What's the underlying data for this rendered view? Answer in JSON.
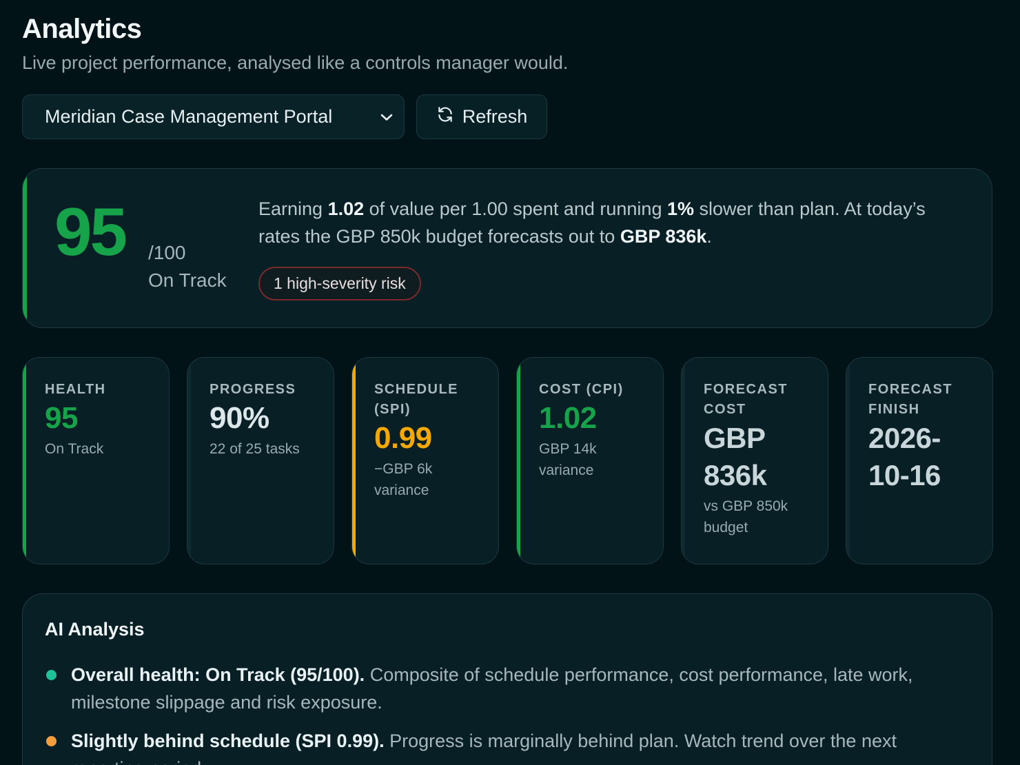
{
  "header": {
    "title": "Analytics",
    "subtitle": "Live project performance, analysed like a controls manager would."
  },
  "controls": {
    "project_select": "Meridian Case Management Portal",
    "refresh_label": "Refresh"
  },
  "hero": {
    "score": "95",
    "max": "/100",
    "status": "On Track",
    "text_parts": {
      "p1": "Earning ",
      "b1": "1.02",
      "p2": " of value per 1.00 spent and running ",
      "b2": "1%",
      "p3": " slower than plan. At today’s rates the GBP 850k budget forecasts out to ",
      "b3": "GBP 836k",
      "p4": "."
    },
    "risk_pill": "1 high-severity risk"
  },
  "cards": [
    {
      "label": "Health",
      "value": "95",
      "sub": "On Track",
      "accent": "#16a34a",
      "value_color": "#16a34a"
    },
    {
      "label": "Progress",
      "value": "90%",
      "sub": "22 of 25 tasks",
      "accent": "#0f2a30",
      "value_color": "#dde7e9"
    },
    {
      "label": "Schedule (SPI)",
      "value": "0.99",
      "sub": "−GBP 6k variance",
      "accent": "#f5a800",
      "value_color": "#f5a800"
    },
    {
      "label": "Cost (CPI)",
      "value": "1.02",
      "sub": "GBP 14k variance",
      "accent": "#16a34a",
      "value_color": "#16a34a"
    },
    {
      "label": "Forecast Cost",
      "value": "GBP 836k",
      "sub": "vs GBP 850k budget",
      "accent": "#0f2a30",
      "value_color": "#c8d6d9"
    },
    {
      "label": "Forecast Finish",
      "value": "2026-10-16",
      "sub": "",
      "accent": "#0f2a30",
      "value_color": "#c8d6d9"
    }
  ],
  "analysis": {
    "title": "AI Analysis",
    "items": [
      {
        "bold": "Overall health: On Track (95/100).",
        "text": " Composite of schedule performance, cost performance, late work, milestone slippage and risk exposure.",
        "dot_color": "#1fc39a"
      },
      {
        "bold": "Slightly behind schedule (SPI 0.99).",
        "text": " Progress is marginally behind plan. Watch trend over the next reporting period.",
        "dot_color": "#f59e3b"
      }
    ]
  }
}
